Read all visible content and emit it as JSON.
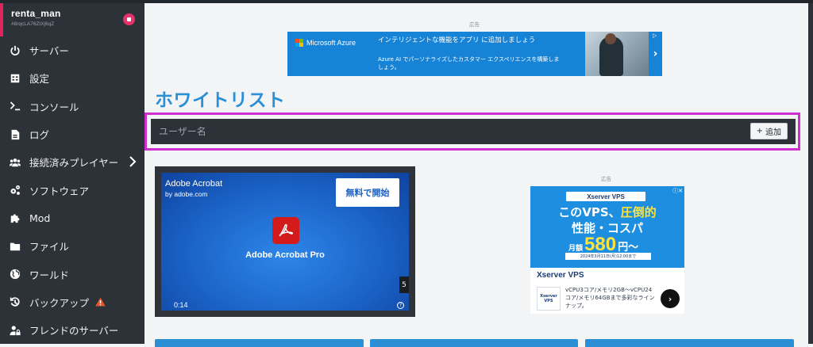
{
  "sidebar": {
    "server_name": "renta_man",
    "server_id": "#8rqcLA76ZtXj6qZ",
    "items": [
      {
        "label": "サーバー",
        "icon": "power-icon"
      },
      {
        "label": "設定",
        "icon": "settings-panel-icon"
      },
      {
        "label": "コンソール",
        "icon": "terminal-icon"
      },
      {
        "label": "ログ",
        "icon": "log-file-icon"
      },
      {
        "label": "接続済みプレイヤー",
        "icon": "users-icon"
      },
      {
        "label": "ソフトウェア",
        "icon": "cogs-icon"
      },
      {
        "label": "Mod",
        "icon": "puzzle-icon"
      },
      {
        "label": "ファイル",
        "icon": "folder-icon"
      },
      {
        "label": "ワールド",
        "icon": "globe-icon"
      },
      {
        "label": "バックアップ",
        "icon": "history-icon"
      },
      {
        "label": "フレンドのサーバー",
        "icon": "user-lock-icon"
      }
    ]
  },
  "ads": {
    "label": "広告",
    "azure": {
      "brand": "Microsoft Azure",
      "headline": "インテリジェントな機能をアプリ に追加しましょう",
      "body": "Azure AI でパーソナライズしたカスタマー エクスペリエンスを構築しましょう。",
      "next": "›"
    },
    "acrobat": {
      "brand": "Adobe Acrobat",
      "by": "by adobe.com",
      "cta": "無料で開始",
      "product": "Adobe Acrobat Pro",
      "time": "0:14",
      "skip": "5",
      "info": "?"
    },
    "xserver": {
      "pill": "Xserver VPS",
      "line1_a": "このVPS、",
      "line1_b": "圧倒的",
      "line2": "性能・コスパ",
      "price_prefix": "月額",
      "price": "580",
      "price_suffix": "円〜",
      "period": "2024年3月11日(月)12:00まで",
      "title": "Xserver VPS",
      "logo_top": "Xserver",
      "logo_bottom": "VPS",
      "desc": "vCPU3コア/メモリ2GB〜vCPU24コア/メモリ64GBまで多彩なラインナップ。",
      "go": "›"
    }
  },
  "main": {
    "title": "ホワイトリスト",
    "username_placeholder": "ユーザー名",
    "add_label": "追加",
    "add_icon": "+"
  },
  "colors": {
    "accent": "#2b8fd6",
    "sidebar_bg": "#2d3239",
    "highlight": "#d02fd0",
    "stop": "#e8336a",
    "warning": "#e4572e"
  }
}
